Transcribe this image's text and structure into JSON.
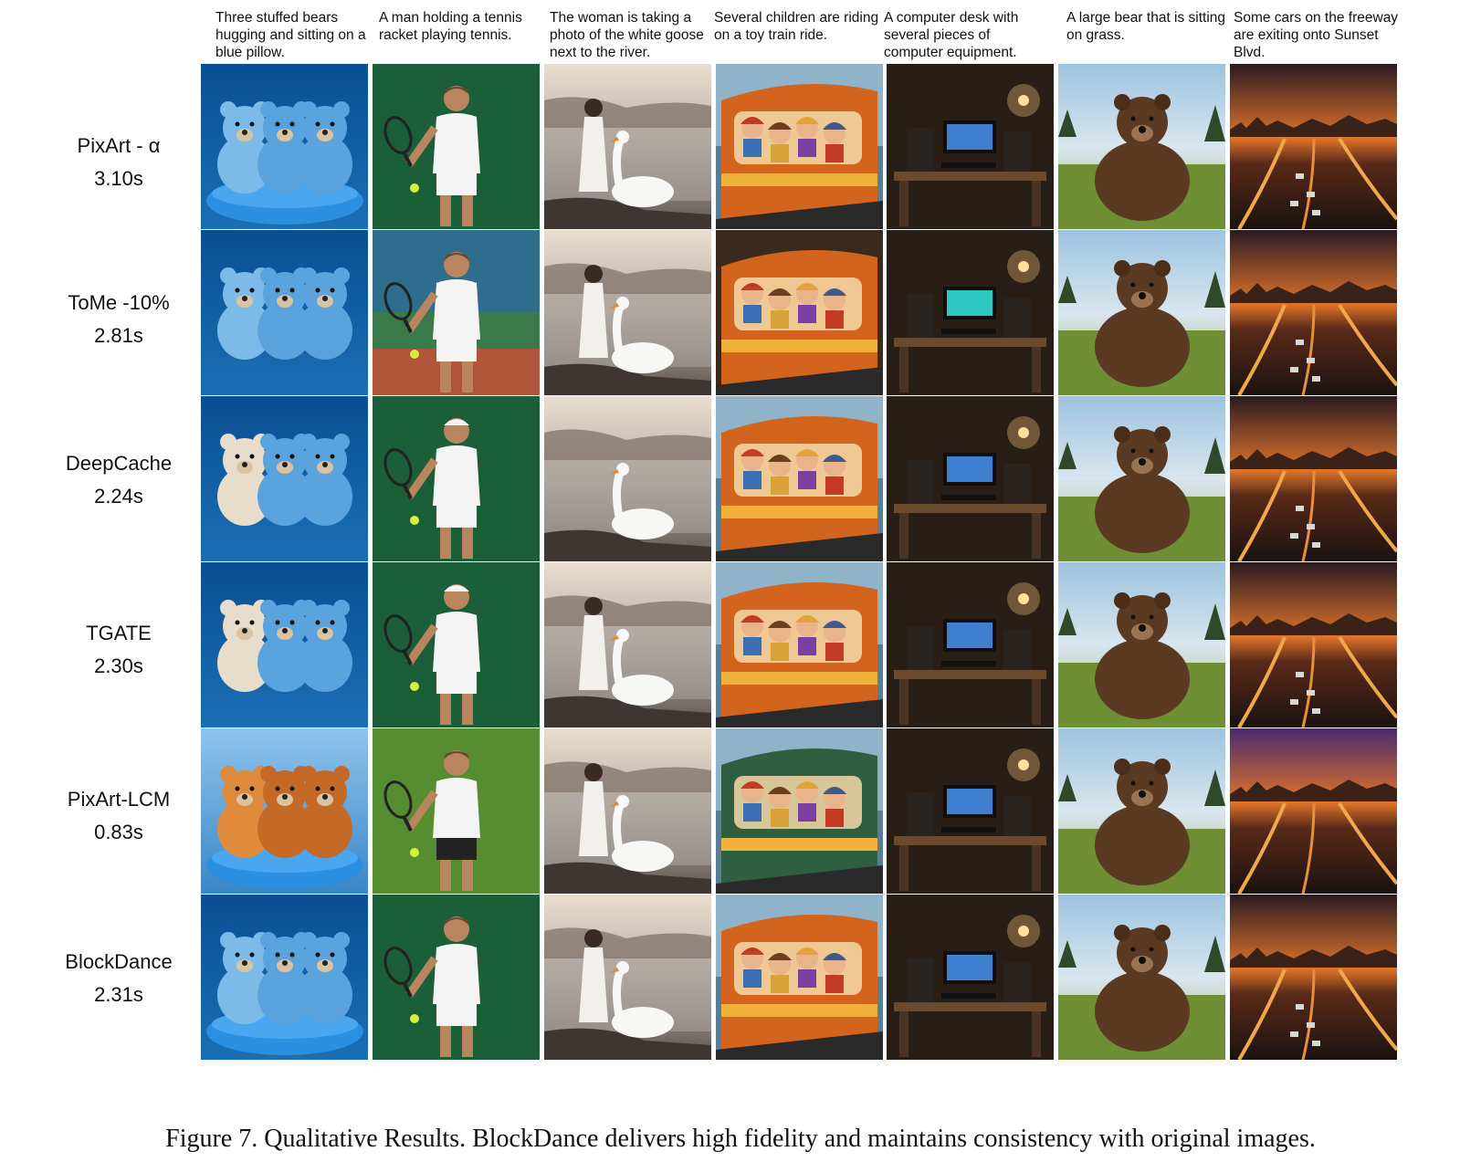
{
  "prompts": [
    "Three stuffed bears hugging and sitting on a blue pillow.",
    "A man holding a tennis racket playing tennis.",
    "The woman is taking a photo of the white goose next to the river.",
    "Several children are riding on a toy train ride.",
    "A computer desk with several pieces of computer equipment.",
    "A large bear that is sitting on grass.",
    "Some cars on the freeway are exiting onto Sunset Blvd."
  ],
  "rows": [
    {
      "method": "PixArt - α",
      "time": "3.10s"
    },
    {
      "method": "ToMe -10%",
      "time": "2.81s"
    },
    {
      "method": "DeepCache",
      "time": "2.24s"
    },
    {
      "method": "TGATE",
      "time": "2.30s"
    },
    {
      "method": "PixArt-LCM",
      "time": "0.83s"
    },
    {
      "method": "BlockDance",
      "time": "2.31s"
    }
  ],
  "scenes": [
    "teddy-bears",
    "tennis-player",
    "woman-goose",
    "toy-train",
    "computer-desk",
    "brown-bear",
    "freeway-sunset"
  ],
  "figure_caption": "Figure 7. Qualitative Results. BlockDance delivers high fidelity and maintains consistency with original images."
}
